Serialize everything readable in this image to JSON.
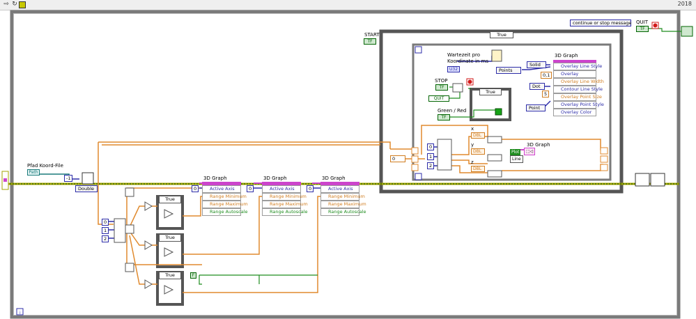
{
  "toolbar": {
    "version": "2018"
  },
  "loop_index": "i",
  "labels": {
    "start": "START",
    "pfad": "Pfad Koord-File",
    "wartezeit": "Wartezeit pro Koordinate in ms",
    "stop": "STOP",
    "green_red": "Green / Red",
    "quit": "QUIT",
    "x": "x",
    "y": "y",
    "z": "z"
  },
  "message_ring": "continue or stop message",
  "true_case": "True",
  "double_label": "Double",
  "points_enum": "Points",
  "constants": {
    "neg_one": "-1",
    "zero_0": "0",
    "zero_1": "0",
    "zero_2": "0",
    "zero_3": "0",
    "zero_4": "0",
    "one": "1",
    "two": "2",
    "zero_small": "0",
    "line_width": "0,1",
    "point_size": "5",
    "two_b": "2"
  },
  "enums": {
    "solid": "Solid",
    "dot": "Dot",
    "point": "Point"
  },
  "terminals": {
    "start": "TF",
    "stop": "TF",
    "green_red": "TF",
    "quit_out": "TF",
    "quit_local": "QUIT",
    "wartezeit": "U32",
    "pfad": "Path",
    "x": "DBL",
    "y": "DBL",
    "z": "DBL"
  },
  "graphs": {
    "main": {
      "title": "3D Graph",
      "props": [
        "Overlay Line Style",
        "Overlay",
        "Overlay Line Width",
        "Contour Line Style",
        "Overlay Point Size",
        "Overlay Point Style",
        "Overlay Color"
      ]
    },
    "small": {
      "title": "3D Graph"
    },
    "axis1": {
      "title": "3D Graph",
      "props": [
        "Active Axis",
        "Range Minimum",
        "Range Maximum",
        "Range Autoscale"
      ]
    },
    "axis2": {
      "title": "3D Graph",
      "props": [
        "Active Axis",
        "Range Minimum",
        "Range Maximum",
        "Range Autoscale"
      ]
    },
    "axis3": {
      "title": "3D Graph",
      "props": [
        "Active Axis",
        "Range Minimum",
        "Range Maximum",
        "Range Autoscale"
      ]
    }
  },
  "plot_labels": {
    "plot": "Plot",
    "line": "Line"
  },
  "ring_false": "F"
}
